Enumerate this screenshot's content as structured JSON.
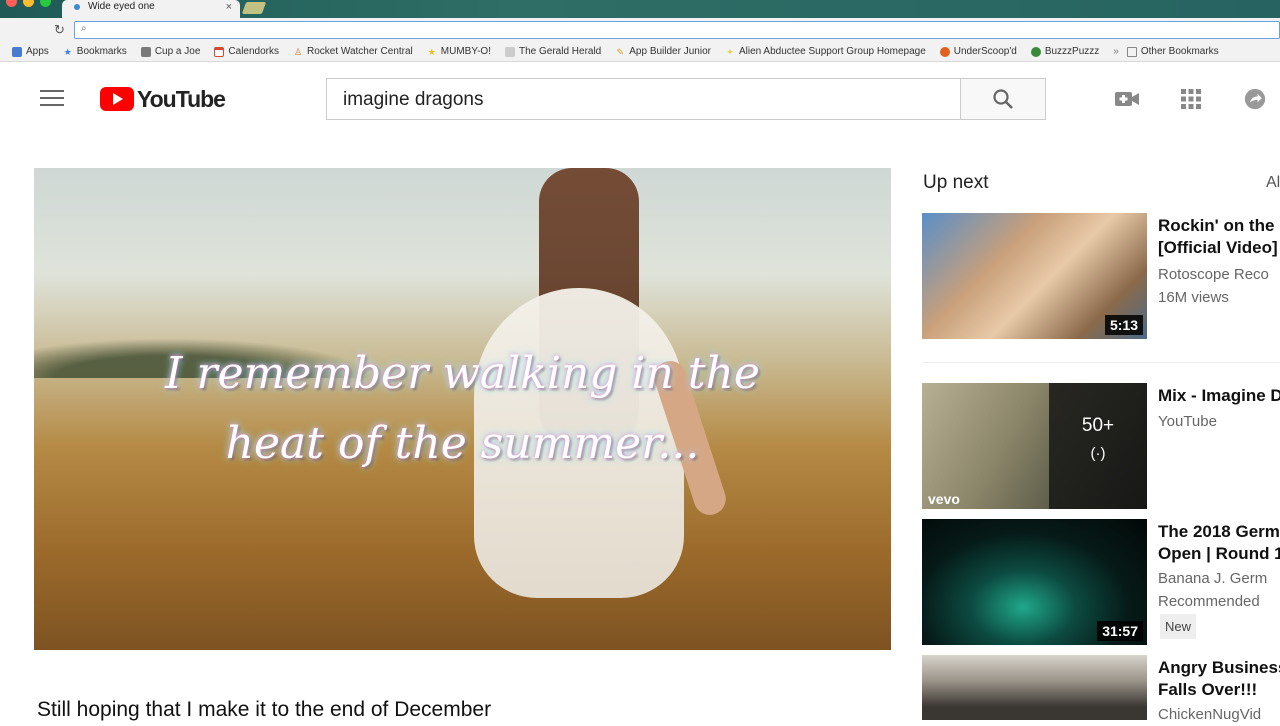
{
  "browser": {
    "tab_title": "Wide eyed one",
    "tab_close": "×",
    "bookmarks": [
      {
        "label": "Apps",
        "icon": "apps-grid-icon",
        "color": "#4a7bd0"
      },
      {
        "label": "Bookmarks",
        "icon": "star-icon",
        "color": "#3d7de0"
      },
      {
        "label": "Cup a Joe",
        "icon": "cup-icon",
        "color": "#7a7a7a"
      },
      {
        "label": "Calendorks",
        "icon": "calendar-icon",
        "color": "#d04a3a"
      },
      {
        "label": "Rocket Watcher Central",
        "icon": "rocket-icon",
        "color": "#d07a2a"
      },
      {
        "label": "MUMBY-O!",
        "icon": "star-burst-icon",
        "color": "#e8c21a"
      },
      {
        "label": "The Gerald Herald",
        "icon": "newspaper-icon",
        "color": "#aaaaaa"
      },
      {
        "label": "App Builder Junior",
        "icon": "pencil-icon",
        "color": "#e0a020"
      },
      {
        "label": "Alien Abductee Support Group Homepage",
        "icon": "sparkle-icon",
        "color": "#e8d040"
      },
      {
        "label": "UnderScoop'd",
        "icon": "fox-icon",
        "color": "#e06020"
      },
      {
        "label": "BuzzzPuzzz",
        "icon": "bee-icon",
        "color": "#3a8a3a"
      }
    ],
    "more_chevron": "»",
    "other_bookmarks": "Other Bookmarks"
  },
  "youtube": {
    "logo_text": "YouTube",
    "search_query": "imagine dragons"
  },
  "player": {
    "lyric_line_1": "I remember walking in the",
    "lyric_line_2": "heat of the summer...",
    "video_title": "Still hoping that I make it to the end of December"
  },
  "sidebar": {
    "up_next": "Up next",
    "autoplay": "Al",
    "recommendations": [
      {
        "title": "Rockin' on the\n[Official Video]",
        "meta": [
          "Rotoscope Reco",
          "16M views"
        ],
        "duration": "5:13"
      },
      {
        "title": "Mix - Imagine D",
        "meta": [
          "YouTube"
        ],
        "mix_count": "50+",
        "mix_icon": "(·)",
        "vevo": "vevo"
      },
      {
        "title": "The 2018 Germ\nOpen | Round 1",
        "meta": [
          "Banana J. Germ",
          "Recommended"
        ],
        "badge": "New",
        "duration": "31:57"
      },
      {
        "title": "Angry Business\nFalls Over!!!",
        "meta": [
          "ChickenNugVid"
        ]
      }
    ]
  }
}
